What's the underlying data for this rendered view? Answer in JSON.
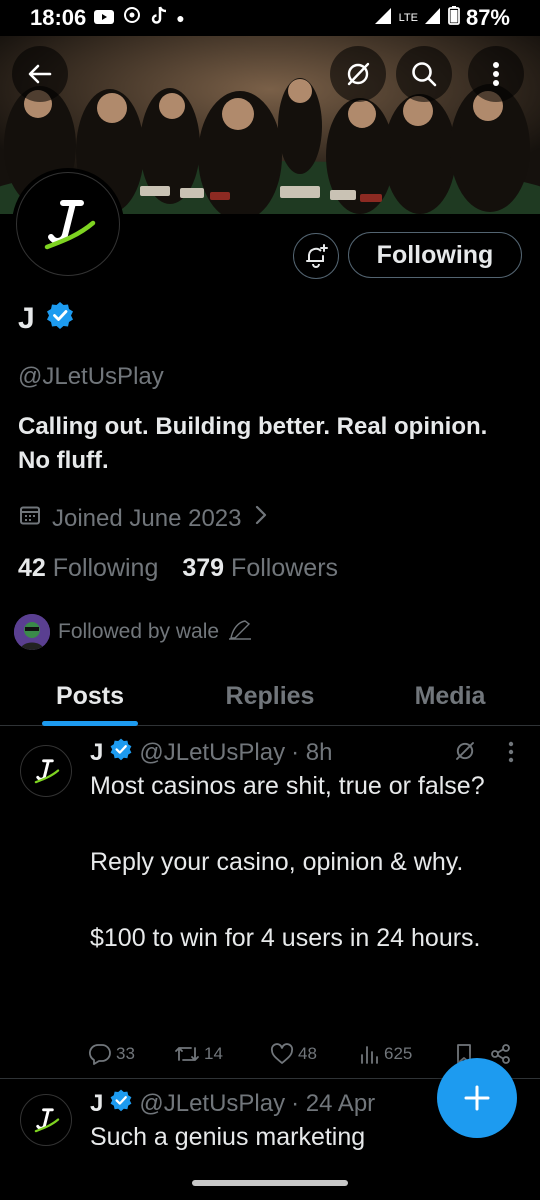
{
  "status_bar": {
    "time": "18:06",
    "network": "LTE",
    "battery": "87%"
  },
  "profile": {
    "name": "J",
    "handle": "@JLetUsPlay",
    "bio": "Calling out. Building better. Real opinion. No fluff.",
    "joined": "Joined June 2023",
    "following_count": "42",
    "following_label": "Following",
    "followers_count": "379",
    "followers_label": "Followers",
    "followed_by": "Followed by wale",
    "follow_button": "Following"
  },
  "tabs": [
    {
      "label": "Posts",
      "active": true
    },
    {
      "label": "Replies",
      "active": false
    },
    {
      "label": "Media",
      "active": false
    }
  ],
  "tweets": [
    {
      "name": "J",
      "handle": "@JLetUsPlay",
      "time": "· 8h",
      "text": "Most casinos are shit, true or false?\n\nReply your casino, opinion & why.\n\n$100 to win for 4 users in 24 hours.",
      "replies": "33",
      "reposts": "14",
      "likes": "48",
      "views": "625"
    },
    {
      "name": "J",
      "handle": "@JLetUsPlay",
      "time": "· 24 Apr",
      "text": "Such a genius marketing"
    }
  ],
  "colors": {
    "accent": "#1d9bf0",
    "muted": "#71767b",
    "text": "#e7e9ea",
    "logo_green": "#7ed321"
  }
}
